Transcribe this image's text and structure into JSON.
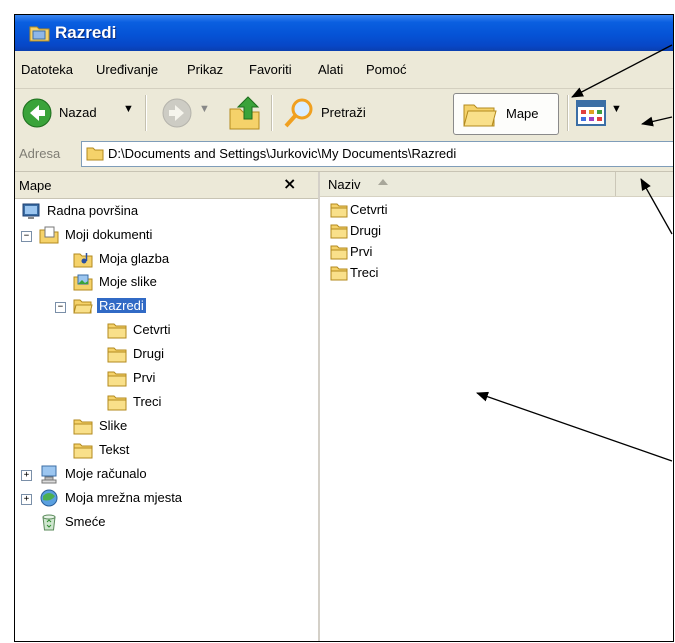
{
  "window": {
    "title": "Razredi",
    "icon": "folder-icon"
  },
  "menu": [
    "Datoteka",
    "Uređivanje",
    "Prikaz",
    "Favoriti",
    "Alati",
    "Pomoć"
  ],
  "toolbar": {
    "back_label": "Nazad",
    "search_label": "Pretraži",
    "folders_label": "Mape"
  },
  "address": {
    "label": "Adresa",
    "path": "D:\\Documents and Settings\\Jurkovic\\My Documents\\Razredi"
  },
  "left_pane": {
    "title": "Mape",
    "close": "×",
    "tree": [
      {
        "label": "Radna površina"
      },
      {
        "label": "Moji dokumenti",
        "expander": "−"
      },
      {
        "label": "Moja glazba"
      },
      {
        "label": "Moje slike"
      },
      {
        "label": "Razredi",
        "expander": "−",
        "selected": true
      },
      {
        "label": "Cetvrti"
      },
      {
        "label": "Drugi"
      },
      {
        "label": "Prvi"
      },
      {
        "label": "Treci"
      },
      {
        "label": "Slike"
      },
      {
        "label": "Tekst"
      },
      {
        "label": "Moje računalo",
        "expander": "+"
      },
      {
        "label": "Moja mrežna mjesta",
        "expander": "+"
      },
      {
        "label": "Smeće"
      }
    ]
  },
  "right_pane": {
    "column_header": "Naziv",
    "items": [
      "Cetvrti",
      "Drugi",
      "Prvi",
      "Treci"
    ]
  },
  "colors": {
    "titlebar": "#0553d6",
    "selection": "#316ac5",
    "folder": "#f5d26a"
  }
}
